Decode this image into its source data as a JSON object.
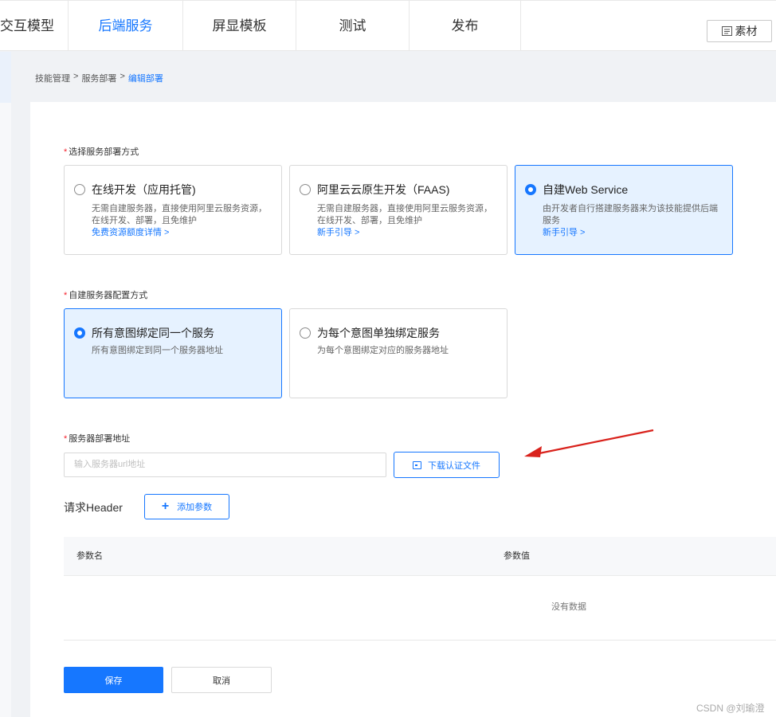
{
  "nav": {
    "tabs": [
      {
        "label": "交互模型",
        "active": false
      },
      {
        "label": "后端服务",
        "active": true
      },
      {
        "label": "屏显模板",
        "active": false
      },
      {
        "label": "测试",
        "active": false
      },
      {
        "label": "发布",
        "active": false
      }
    ],
    "material_label": "素材"
  },
  "breadcrumb": {
    "items": [
      "技能管理",
      "服务部署",
      "编辑部署"
    ],
    "separator": ">"
  },
  "deploy_method": {
    "label": "选择服务部署方式",
    "options": [
      {
        "title": "在线开发（应用托管)",
        "desc": "无需自建服务器，直接使用阿里云服务资源，在线开发、部署，且免维护",
        "link": "免费资源额度详情 >",
        "selected": false
      },
      {
        "title": "阿里云云原生开发（FAAS)",
        "desc": "无需自建服务器，直接使用阿里云服务资源，在线开发、部署，且免维护",
        "link": "新手引导 >",
        "selected": false
      },
      {
        "title": "自建Web Service",
        "desc": "由开发者自行搭建服务器来为该技能提供后端服务",
        "link": "新手引导 >",
        "selected": true
      }
    ]
  },
  "server_config": {
    "label": "自建服务器配置方式",
    "options": [
      {
        "title": "所有意图绑定同一个服务",
        "desc": "所有意图绑定到同一个服务器地址",
        "selected": true
      },
      {
        "title": "为每个意图单独绑定服务",
        "desc": "为每个意图绑定对应的服务器地址",
        "selected": false
      }
    ]
  },
  "server_address": {
    "label": "服务器部署地址",
    "placeholder": "输入服务器url地址",
    "download_label": "下载认证文件"
  },
  "header": {
    "label": "请求Header",
    "add_label": "添加参数",
    "columns": [
      "参数名",
      "参数值"
    ],
    "empty_text": "没有数据"
  },
  "actions": {
    "save": "保存",
    "cancel": "取消"
  },
  "watermark": "CSDN @刘瑜澄",
  "colors": {
    "accent": "#1677ff",
    "required": "#f5222d",
    "arrow": "#d9221c"
  }
}
